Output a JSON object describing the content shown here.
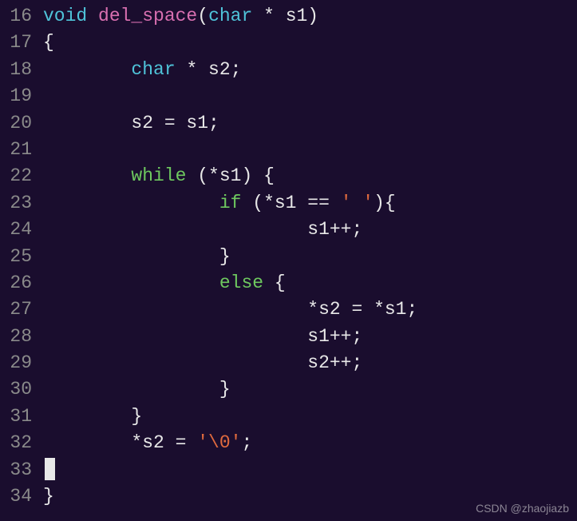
{
  "startLine": 16,
  "watermark": "CSDN @zhaojiazb",
  "lines": [
    {
      "tokens": [
        {
          "cls": "type",
          "t": "void "
        },
        {
          "cls": "fn",
          "t": "del_space"
        },
        {
          "cls": "punct",
          "t": "("
        },
        {
          "cls": "type",
          "t": "char "
        },
        {
          "cls": "punct",
          "t": "* "
        },
        {
          "cls": "ident",
          "t": "s1"
        },
        {
          "cls": "punct",
          "t": ")"
        }
      ]
    },
    {
      "tokens": [
        {
          "cls": "punct",
          "t": "{"
        }
      ]
    },
    {
      "tokens": [
        {
          "cls": "",
          "t": "        "
        },
        {
          "cls": "type",
          "t": "char "
        },
        {
          "cls": "punct",
          "t": "* "
        },
        {
          "cls": "ident",
          "t": "s2;"
        }
      ]
    },
    {
      "tokens": [
        {
          "cls": "",
          "t": ""
        }
      ]
    },
    {
      "tokens": [
        {
          "cls": "",
          "t": "        "
        },
        {
          "cls": "ident",
          "t": "s2 = s1;"
        }
      ]
    },
    {
      "tokens": [
        {
          "cls": "",
          "t": ""
        }
      ]
    },
    {
      "tokens": [
        {
          "cls": "",
          "t": "        "
        },
        {
          "cls": "kw",
          "t": "while "
        },
        {
          "cls": "punct",
          "t": "(*s1) {"
        }
      ]
    },
    {
      "tokens": [
        {
          "cls": "",
          "t": "                "
        },
        {
          "cls": "kw",
          "t": "if "
        },
        {
          "cls": "punct",
          "t": "(*s1 == "
        },
        {
          "cls": "str",
          "t": "' '"
        },
        {
          "cls": "punct",
          "t": "){"
        }
      ]
    },
    {
      "tokens": [
        {
          "cls": "",
          "t": "                        "
        },
        {
          "cls": "ident",
          "t": "s1++;"
        }
      ]
    },
    {
      "tokens": [
        {
          "cls": "",
          "t": "                "
        },
        {
          "cls": "punct",
          "t": "}"
        }
      ]
    },
    {
      "tokens": [
        {
          "cls": "",
          "t": "                "
        },
        {
          "cls": "kw",
          "t": "else "
        },
        {
          "cls": "punct",
          "t": "{"
        }
      ]
    },
    {
      "tokens": [
        {
          "cls": "",
          "t": "                        "
        },
        {
          "cls": "ident",
          "t": "*s2 = *s1;"
        }
      ]
    },
    {
      "tokens": [
        {
          "cls": "",
          "t": "                        "
        },
        {
          "cls": "ident",
          "t": "s1++;"
        }
      ]
    },
    {
      "tokens": [
        {
          "cls": "",
          "t": "                        "
        },
        {
          "cls": "ident",
          "t": "s2++;"
        }
      ]
    },
    {
      "tokens": [
        {
          "cls": "",
          "t": "                "
        },
        {
          "cls": "punct",
          "t": "}"
        }
      ]
    },
    {
      "tokens": [
        {
          "cls": "",
          "t": "        "
        },
        {
          "cls": "punct",
          "t": "}"
        }
      ]
    },
    {
      "tokens": [
        {
          "cls": "",
          "t": "        "
        },
        {
          "cls": "ident",
          "t": "*s2 = "
        },
        {
          "cls": "str",
          "t": "'\\0'"
        },
        {
          "cls": "punct",
          "t": ";"
        }
      ]
    },
    {
      "tokens": [],
      "cursor": true
    },
    {
      "tokens": [
        {
          "cls": "punct",
          "t": "}"
        }
      ]
    }
  ]
}
